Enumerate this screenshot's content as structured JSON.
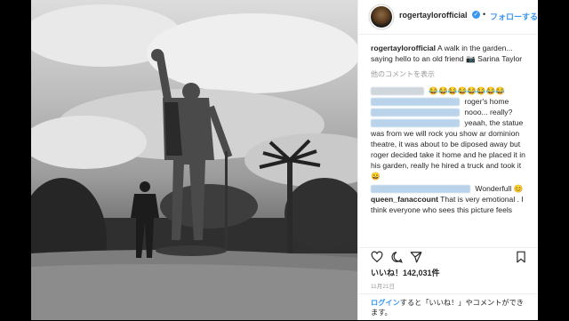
{
  "post": {
    "username": "rogertaylorofficial",
    "follow_label": "フォローする",
    "verified_mark": "✓",
    "separator": "•"
  },
  "comments": {
    "caption_user": "rogertaylorofficial",
    "caption_text": "A walk in the garden... saying hello to an old friend",
    "caption_tail": "Sarina Taylor",
    "view_all": "他のコメントを表示",
    "items": [
      {
        "text": "😂😂😂😂😂😂😂😂"
      },
      {
        "text": "roger's home"
      },
      {
        "text": "nooo... really?"
      },
      {
        "text": "yeaah, the statue was from we will rock you show ar dominion theatre, it was about to be diposed away but roger decided take it home and he placed it in his garden, really he hired a truck and took it 😄"
      },
      {
        "text": "Wonderfull 😊"
      },
      {
        "user": "queen_fanaccount",
        "text": "That is very emotional . I think everyone who sees this picture feels"
      }
    ]
  },
  "stats": {
    "likes": "いいね！142,031件",
    "date": "11月21日"
  },
  "footer": {
    "login": "ログイン",
    "text": "すると「いいね！」やコメントができます。"
  },
  "icons": [
    "heart-icon",
    "comment-icon",
    "share-icon",
    "bookmark-icon"
  ]
}
